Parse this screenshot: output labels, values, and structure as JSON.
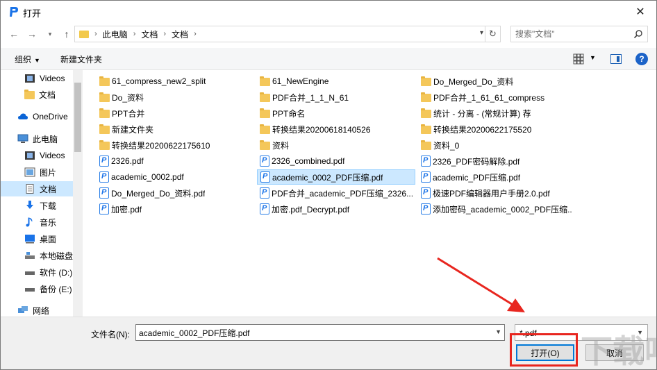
{
  "window": {
    "title": "打开",
    "close_glyph": "✕"
  },
  "nav": {
    "breadcrumbs": [
      "此电脑",
      "文档",
      "文档"
    ],
    "search_placeholder": "搜索\"文档\""
  },
  "toolbar": {
    "organize": "组织",
    "new_folder": "新建文件夹"
  },
  "sidebar": {
    "items": [
      {
        "label": "Videos",
        "icon": "video-icon"
      },
      {
        "label": "文档",
        "icon": "folder-icon"
      },
      {
        "label": "OneDrive",
        "icon": "cloud-icon"
      },
      {
        "label": "此电脑",
        "icon": "computer-icon"
      },
      {
        "label": "Videos",
        "icon": "video-icon"
      },
      {
        "label": "图片",
        "icon": "pictures-icon"
      },
      {
        "label": "文档",
        "icon": "document-icon",
        "selected": true
      },
      {
        "label": "下载",
        "icon": "download-icon"
      },
      {
        "label": "音乐",
        "icon": "music-icon"
      },
      {
        "label": "桌面",
        "icon": "desktop-icon"
      },
      {
        "label": "本地磁盘",
        "icon": "drive-icon"
      },
      {
        "label": "软件 (D:)",
        "icon": "drive-icon"
      },
      {
        "label": "备份 (E:)",
        "icon": "drive-icon"
      },
      {
        "label": "网络",
        "icon": "network-icon"
      }
    ]
  },
  "files": {
    "col1": [
      {
        "name": "61_compress_new2_split",
        "type": "folder"
      },
      {
        "name": "Do_资料",
        "type": "folder"
      },
      {
        "name": "PPT合并",
        "type": "folder"
      },
      {
        "name": "新建文件夹",
        "type": "folder"
      },
      {
        "name": "转换结果20200622175610",
        "type": "folder"
      },
      {
        "name": "2326.pdf",
        "type": "pdf"
      },
      {
        "name": "academic_0002.pdf",
        "type": "pdf"
      },
      {
        "name": "Do_Merged_Do_资料.pdf",
        "type": "pdf"
      },
      {
        "name": "加密.pdf",
        "type": "pdf"
      }
    ],
    "col2": [
      {
        "name": "61_NewEngine",
        "type": "folder"
      },
      {
        "name": "PDF合并_1_1_N_61",
        "type": "folder"
      },
      {
        "name": "PPT命名",
        "type": "folder"
      },
      {
        "name": "转换结果20200618140526",
        "type": "folder"
      },
      {
        "name": "资料",
        "type": "folder"
      },
      {
        "name": "2326_combined.pdf",
        "type": "pdf"
      },
      {
        "name": "academic_0002_PDF压缩.pdf",
        "type": "pdf",
        "selected": true
      },
      {
        "name": "PDF合并_academic_PDF压缩_2326...",
        "type": "pdf"
      },
      {
        "name": "加密.pdf_Decrypt.pdf",
        "type": "pdf"
      }
    ],
    "col3": [
      {
        "name": "Do_Merged_Do_资料",
        "type": "folder"
      },
      {
        "name": "PDF合并_1_61_61_compress",
        "type": "folder"
      },
      {
        "name": "统计 - 分离 - (常规计算) 荐",
        "type": "folder"
      },
      {
        "name": "转换结果20200622175520",
        "type": "folder"
      },
      {
        "name": "资料_0",
        "type": "folder"
      },
      {
        "name": "2326_PDF密码解除.pdf",
        "type": "pdf"
      },
      {
        "name": "academic_PDF压缩.pdf",
        "type": "pdf"
      },
      {
        "name": "极速PDF编辑器用户手册2.0.pdf",
        "type": "pdf"
      },
      {
        "name": "添加密码_academic_0002_PDF压缩...",
        "type": "pdf"
      }
    ]
  },
  "bottom": {
    "filename_label": "文件名(N):",
    "filename_value": "academic_0002_PDF压缩.pdf",
    "filter_value": "*.pdf",
    "open_label": "打开(O)",
    "cancel_label": "取消"
  },
  "watermark": "下载吧",
  "colors": {
    "accent": "#0078d7",
    "selection": "#cce8ff",
    "annotation": "#e8261f",
    "folder": "#f4c75a"
  }
}
